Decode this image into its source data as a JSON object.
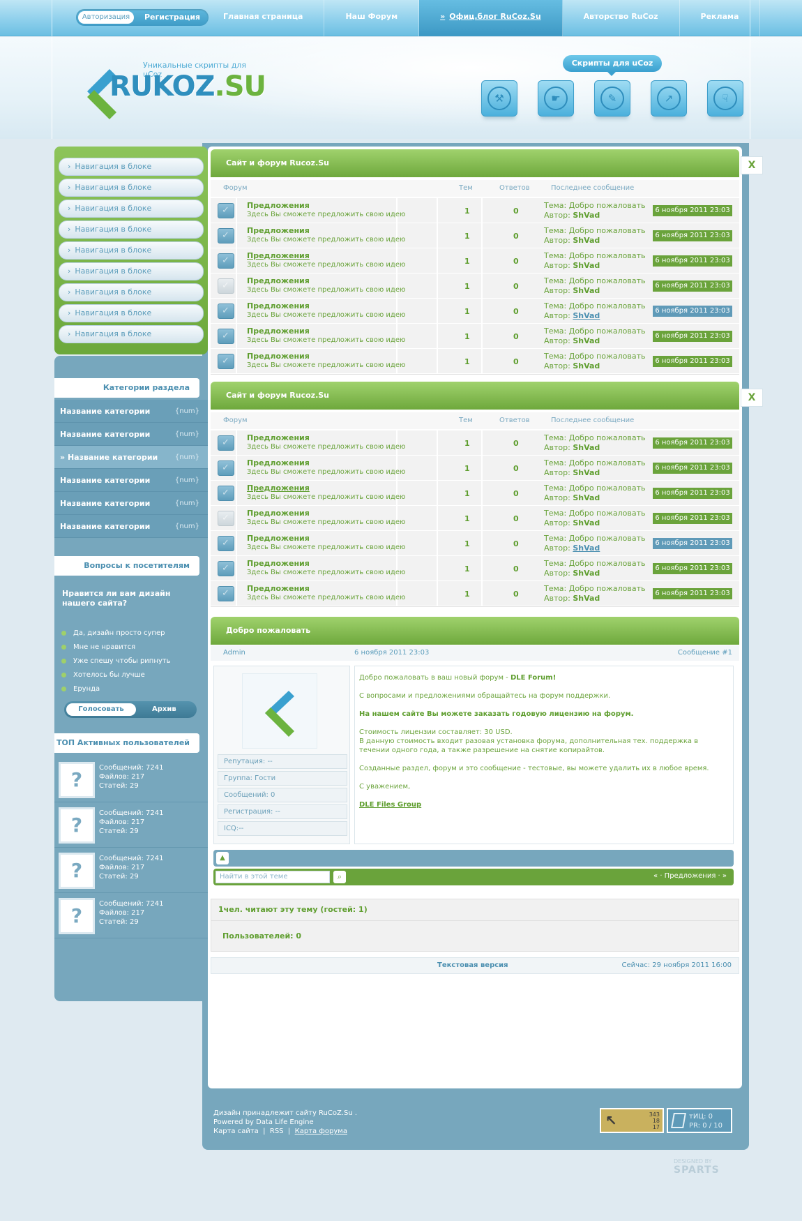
{
  "topbar": {
    "login": "Авторизация",
    "register": "Регистрация",
    "nav": [
      {
        "label": "Главная страница"
      },
      {
        "label": "Наш Форум"
      },
      {
        "label": "Офиц.блог RuCoz.Su",
        "active": true
      },
      {
        "label": "Авторство RuCoz"
      },
      {
        "label": "Реклама"
      }
    ]
  },
  "header": {
    "tagline": "Уникальные скрипты для uCoz",
    "logo_main": "RUKOZ",
    "logo_suffix": ".SU",
    "scripts_badge": "Скрипты для uCoz",
    "tiles": [
      "wrench-icon",
      "hand-pointer-icon",
      "pencil-icon",
      "chart-arrow-icon",
      "hand-download-icon"
    ]
  },
  "sidebar": {
    "nav_items": [
      "Навигация в блоке",
      "Навигация в блоке",
      "Навигация в блоке",
      "Навигация в блоке",
      "Навигация в блоке",
      "Навигация в блоке",
      "Навигация в блоке",
      "Навигация в блоке",
      "Навигация в блоке"
    ],
    "categories_title": "Категории раздела",
    "categories": [
      {
        "name": "Название категории",
        "num": "{num}"
      },
      {
        "name": "Название категории",
        "num": "{num}"
      },
      {
        "name": "Название категории",
        "num": "{num}",
        "active": true
      },
      {
        "name": "Название категории",
        "num": "{num}"
      },
      {
        "name": "Название категории",
        "num": "{num}"
      },
      {
        "name": "Название категории",
        "num": "{num}"
      }
    ],
    "poll_title": "Вопросы к посетителям",
    "poll_question": "Нравится ли вам дизайн нашего сайта?",
    "poll_options": [
      "Да, дизайн просто супер",
      "Мне не нравится",
      "Уже спешу чтобы рипнуть",
      "Хотелось бы лучше",
      "Ерунда"
    ],
    "poll_vote": "Голосовать",
    "poll_archive": "Архив",
    "top_title": "ТОП Активных пользователей",
    "top_users": [
      {
        "posts": "Сообщений: 7241",
        "files": "Файлов: 217",
        "articles": "Статей: 29"
      },
      {
        "posts": "Сообщений: 7241",
        "files": "Файлов: 217",
        "articles": "Статей: 29"
      },
      {
        "posts": "Сообщений: 7241",
        "files": "Файлов: 217",
        "articles": "Статей: 29"
      },
      {
        "posts": "Сообщений: 7241",
        "files": "Файлов: 217",
        "articles": "Статей: 29"
      }
    ]
  },
  "forum": {
    "title": "Сайт и форум Rucoz.Su",
    "close": "X",
    "columns": [
      "Форум",
      "Тем",
      "Ответов",
      "Последнее сообщение"
    ],
    "rows": [
      {
        "name": "Предложения",
        "desc": "Здесь Вы сможете предложить свою идею",
        "topics": "1",
        "replies": "0",
        "last_topic": "Тема: Добро пожаловать",
        "author_label": "Автор: ",
        "author": "ShVad",
        "date": "6 ноября 2011 23:03",
        "read": true,
        "underline": false,
        "highlight": false
      },
      {
        "name": "Предложения",
        "desc": "Здесь Вы сможете предложить свою идею",
        "topics": "1",
        "replies": "0",
        "last_topic": "Тема: Добро пожаловать",
        "author_label": "Автор: ",
        "author": "ShVad",
        "date": "6 ноября 2011 23:03",
        "read": true,
        "underline": false,
        "highlight": false
      },
      {
        "name": "Предложения",
        "desc": "Здесь Вы сможете предложить свою идею",
        "topics": "1",
        "replies": "0",
        "last_topic": "Тема: Добро пожаловать",
        "author_label": "Автор: ",
        "author": "ShVad",
        "date": "6 ноября 2011 23:03",
        "read": true,
        "underline": true,
        "highlight": false
      },
      {
        "name": "Предложения",
        "desc": "Здесь Вы сможете предложить свою идею",
        "topics": "1",
        "replies": "0",
        "last_topic": "Тема: Добро пожаловать",
        "author_label": "Автор: ",
        "author": "ShVad",
        "date": "6 ноября 2011 23:03",
        "read": false,
        "underline": false,
        "highlight": false
      },
      {
        "name": "Предложения",
        "desc": "Здесь Вы сможете предложить свою идею",
        "topics": "1",
        "replies": "0",
        "last_topic": "Тема: Добро пожаловать",
        "author_label": "Автор: ",
        "author": "ShVad",
        "date": "6 ноября 2011 23:03",
        "read": true,
        "underline": false,
        "highlight": true
      },
      {
        "name": "Предложения",
        "desc": "Здесь Вы сможете предложить свою идею",
        "topics": "1",
        "replies": "0",
        "last_topic": "Тема: Добро пожаловать",
        "author_label": "Автор: ",
        "author": "ShVad",
        "date": "6 ноября 2011 23:03",
        "read": true,
        "underline": false,
        "highlight": false
      },
      {
        "name": "Предложения",
        "desc": "Здесь Вы сможете предложить свою идею",
        "topics": "1",
        "replies": "0",
        "last_topic": "Тема: Добро пожаловать",
        "author_label": "Автор: ",
        "author": "ShVad",
        "date": "6 ноября 2011 23:03",
        "read": true,
        "underline": false,
        "highlight": false
      }
    ]
  },
  "post": {
    "title": "Добро пожаловать",
    "author": "Admin",
    "date": "6 ноября 2011 23:03",
    "number": "Сообщение #1",
    "fields": [
      "Репутация: --",
      "Группа: Гости",
      "Сообщений: 0",
      "Регистрация: --",
      "ICQ:--"
    ],
    "body": {
      "line1_pre": "Добро пожаловать в ваш новый форум - ",
      "line1_bold": "DLE Forum!",
      "line2": "С вопросами и предложениями обращайтесь на форум поддержки.",
      "line3": "На нашем сайте Вы можете заказать годовую лицензию на форум.",
      "line4": "Стоимость лицензии составляет: 30 USD.",
      "line5": "В данную стоимость входит разовая установка форума, дополнительная тех. поддержка в течении одного года, а также разрешение на снятие копирайтов.",
      "line6": "Созданные раздел, форум и это сообщение - тестовые, вы можете удалить их в любое время.",
      "line7": "С уважением,",
      "signature": "DLE Files Group"
    },
    "search_placeholder": "Найти в этой теме",
    "nav_text": "« · Предложения · »",
    "readers": "1чел. читают эту тему (гостей: 1)",
    "users": "Пользователей: 0",
    "text_version": "Текстовая версия",
    "now": "Сейчас: 29 ноября 2011 16:00"
  },
  "footer": {
    "line1": "Дизайн принадлежит сайту RuCoZ.Su .",
    "line2": "Powered by Data Life Engine",
    "sitemap": "Карта сайта",
    "rss": "RSS",
    "forum_map": "Карта форума",
    "counter_nums": [
      "343",
      "18",
      "17"
    ],
    "tic": "тИЦ: 0",
    "pr": "PR: 0 / 10",
    "designed_by": "DESIGNED BY",
    "designer": "SPARTS"
  },
  "colors": {
    "accent_green": "#6aa33b",
    "accent_blue": "#4b8fb0",
    "sidebar_blue": "#77a7bd"
  }
}
